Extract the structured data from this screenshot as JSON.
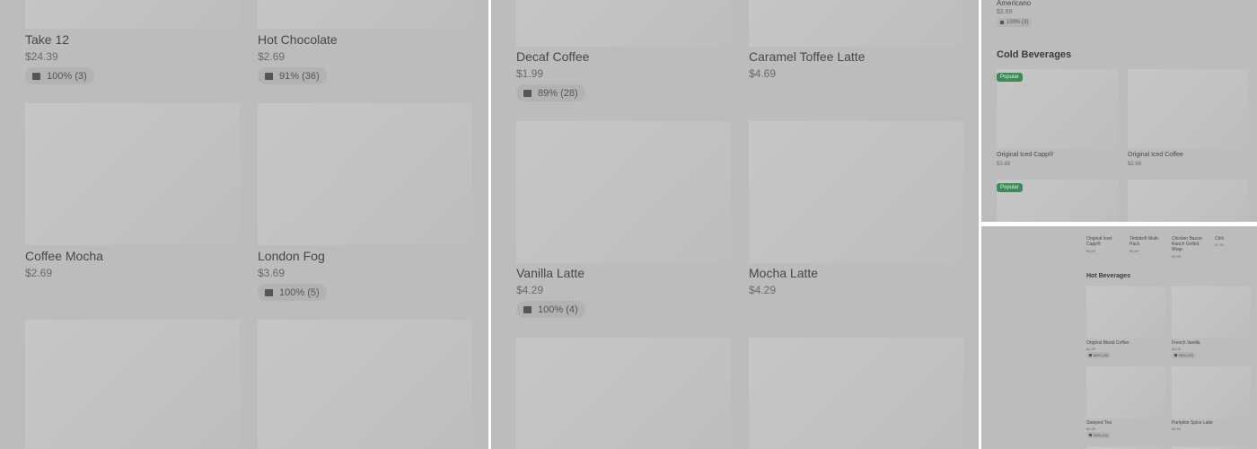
{
  "panel1": {
    "items": [
      {
        "name": "Take 12",
        "price": "$24.39",
        "rating": "100% (3)"
      },
      {
        "name": "Hot Chocolate",
        "price": "$2.69",
        "rating": "91% (36)"
      },
      {
        "name": "Coffee Mocha",
        "price": "$2.69",
        "rating": ""
      },
      {
        "name": "London Fog",
        "price": "$3.69",
        "rating": "100% (5)"
      }
    ]
  },
  "panel2": {
    "items": [
      {
        "name": "Decaf Coffee",
        "price": "$1.99",
        "rating": "89% (28)"
      },
      {
        "name": "Caramel Toffee Latte",
        "price": "$4.69",
        "rating": ""
      },
      {
        "name": "Vanilla Latte",
        "price": "$4.29",
        "rating": "100% (4)"
      },
      {
        "name": "Mocha Latte",
        "price": "$4.29",
        "rating": ""
      }
    ]
  },
  "panel3": {
    "top_item": {
      "name": "Americano",
      "price": "$2.69",
      "rating": "100% (3)"
    },
    "section_title": "Cold Beverages",
    "badge": "Popular",
    "items": [
      {
        "name": "Original Iced Capp®",
        "price": "$3.69"
      },
      {
        "name": "Original Iced Coffee",
        "price": "$2.69"
      }
    ]
  },
  "panel4": {
    "top_items": [
      {
        "name": "Original Iced Capp®",
        "price": "$3.69"
      },
      {
        "name": "Timbits® Multi-Pack",
        "price": "$3.69"
      },
      {
        "name": "Chicken Bacon Ranch Grilled Wrap",
        "price": "$5.59"
      },
      {
        "name": "Chili",
        "price": "$7.39"
      }
    ],
    "section_title": "Hot Beverages",
    "items": [
      {
        "name": "Original Blend Coffee",
        "price": "$1.99",
        "rating": "88% (38)"
      },
      {
        "name": "French Vanilla",
        "price": "$3.09",
        "rating": "88% (29)"
      },
      {
        "name": "Steeped Tea",
        "price": "$2.09",
        "rating": "90% (10)"
      },
      {
        "name": "Pumpkin Spice Latte",
        "price": "$4.69",
        "rating": ""
      }
    ]
  },
  "colors": {
    "overlay": "#bcbcbc",
    "badge": "#3e8a57"
  }
}
